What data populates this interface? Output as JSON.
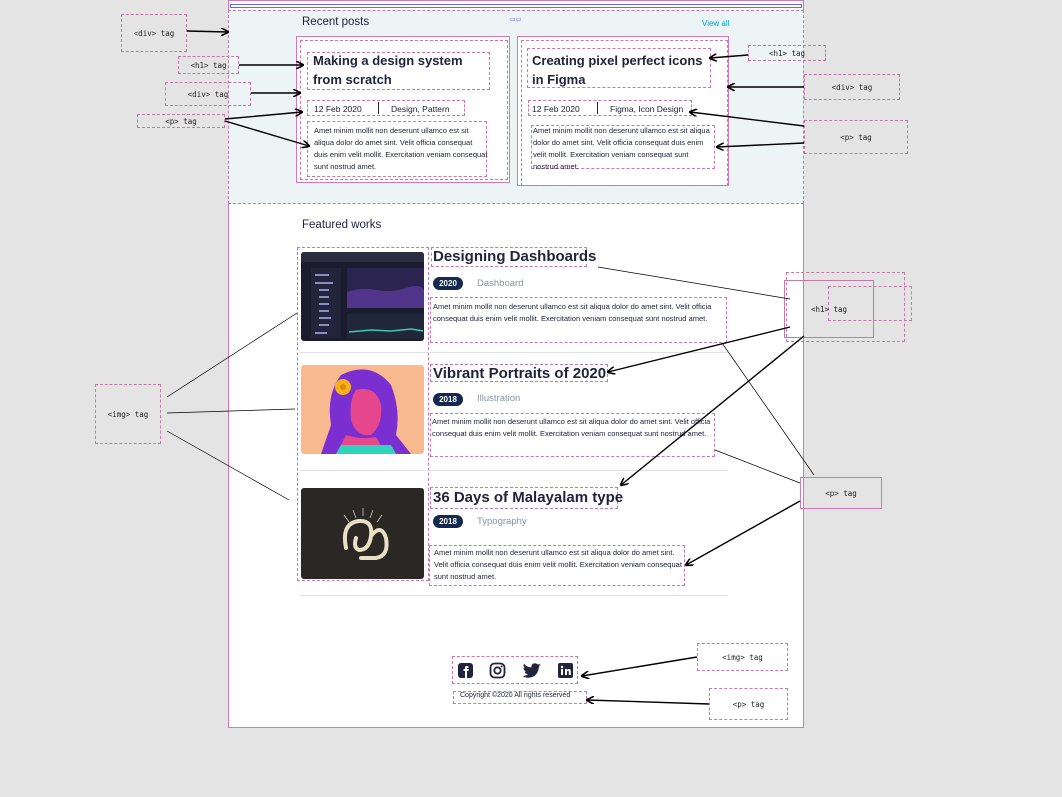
{
  "recent": {
    "heading": "Recent posts",
    "view_all": "View all",
    "posts": [
      {
        "title": "Making a design system from scratch",
        "date": "12 Feb 2020",
        "tags": "Design, Pattern",
        "excerpt": "Amet minim mollit non deserunt ullamco est sit aliqua dolor do amet sint. Velit officia consequat duis enim velit mollit. Exercitation veniam consequat sunt nostrud amet."
      },
      {
        "title": "Creating pixel perfect icons in Figma",
        "date": "12 Feb 2020",
        "tags": "Figma, Icon Design",
        "excerpt": "Amet minim mollit non deserunt ullamco est sit aliqua dolor do amet sint. Velit officia consequat duis enim velit mollit. Exercitation veniam consequat sunt nostrud amet."
      }
    ]
  },
  "featured": {
    "heading": "Featured works",
    "works": [
      {
        "title": "Designing Dashboards",
        "year": "2020",
        "category": "Dashboard",
        "excerpt": "Amet minim mollit non deserunt ullamco est sit aliqua dolor do amet sint. Velit officia consequat duis enim velit mollit. Exercitation veniam consequat sunt nostrud amet."
      },
      {
        "title": "Vibrant Portraits of 2020",
        "year": "2018",
        "category": "Illustration",
        "excerpt": "Amet minim mollit non deserunt ullamco est sit aliqua dolor do amet sint. Velit officia consequat duis enim velit mollit. Exercitation veniam consequat sunt nostrud amet."
      },
      {
        "title": "36 Days of Malayalam type",
        "year": "2018",
        "category": "Typography",
        "excerpt": "Amet minim mollit non deserunt ullamco est sit aliqua dolor do amet sint. Velit officia consequat duis enim velit mollit. Exercitation veniam consequat sunt nostrud amet."
      }
    ]
  },
  "footer": {
    "copyright": "Copyright ©2020 All rights reserved",
    "social_icons": [
      "facebook-icon",
      "instagram-icon",
      "twitter-icon",
      "linkedin-icon"
    ]
  },
  "annotations": {
    "div_tag": "<div> tag",
    "h1_tag": "<h1> tag",
    "p_tag": "<p> tag",
    "img_tag": "<img> tag"
  },
  "colors": {
    "accent": "#00a8cc",
    "dark": "#21243d",
    "navy": "#142850",
    "annotation": "#d27ab8",
    "recent_bg": "#edf4f6"
  }
}
